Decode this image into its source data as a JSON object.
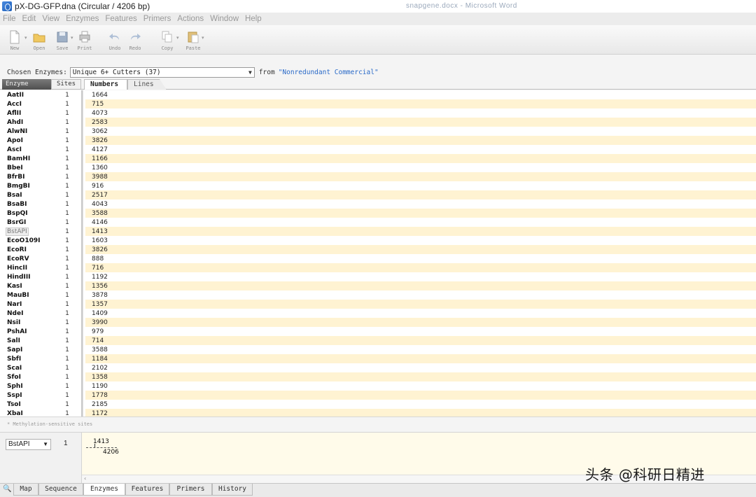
{
  "window": {
    "title": "pX-DG-GFP.dna  (Circular / 4206 bp)",
    "ghost_title": "snapgene.docx  -  Microsoft Word"
  },
  "menu": [
    "File",
    "Edit",
    "View",
    "Enzymes",
    "Features",
    "Primers",
    "Actions",
    "Window",
    "Help"
  ],
  "toolbar": {
    "new": "New",
    "open": "Open",
    "save": "Save",
    "print": "Print",
    "undo": "Undo",
    "redo": "Redo",
    "copy": "Copy",
    "paste": "Paste"
  },
  "chosen": {
    "label": "Chosen Enzymes:",
    "value": "Unique 6+ Cutters  (37)",
    "from_label": "from",
    "from_value": "\"Nonredundant Commercial\""
  },
  "headers": {
    "enzyme": "Enzyme",
    "sites": "Sites"
  },
  "tabs": {
    "numbers": "Numbers",
    "lines": "Lines"
  },
  "enzymes": [
    {
      "name": "AatII",
      "sites": "1",
      "pos": "1664"
    },
    {
      "name": "AccI",
      "sites": "1",
      "pos": "715"
    },
    {
      "name": "AflII",
      "sites": "1",
      "pos": "4073"
    },
    {
      "name": "AhdI",
      "sites": "1",
      "pos": "2583"
    },
    {
      "name": "AlwNI",
      "sites": "1",
      "pos": "3062"
    },
    {
      "name": "ApoI",
      "sites": "1",
      "pos": "3826"
    },
    {
      "name": "AscI",
      "sites": "1",
      "pos": "4127"
    },
    {
      "name": "BamHI",
      "sites": "1",
      "pos": "1166"
    },
    {
      "name": "BbeI",
      "sites": "1",
      "pos": "1360"
    },
    {
      "name": "BfrBI",
      "sites": "1",
      "pos": "3988"
    },
    {
      "name": "BmgBI",
      "sites": "1",
      "pos": "916"
    },
    {
      "name": "BsaI",
      "sites": "1",
      "pos": "2517"
    },
    {
      "name": "BsaBI",
      "sites": "1",
      "pos": "4043"
    },
    {
      "name": "BspQI",
      "sites": "1",
      "pos": "3588"
    },
    {
      "name": "BsrGI",
      "sites": "1",
      "pos": "4146"
    },
    {
      "name": "BstAPI",
      "sites": "1",
      "pos": "1413"
    },
    {
      "name": "EcoO109I",
      "sites": "1",
      "pos": "1603"
    },
    {
      "name": "EcoRI",
      "sites": "1",
      "pos": "3826"
    },
    {
      "name": "EcoRV",
      "sites": "1",
      "pos": "888"
    },
    {
      "name": "HincII",
      "sites": "1",
      "pos": "716"
    },
    {
      "name": "HindIII",
      "sites": "1",
      "pos": "1192"
    },
    {
      "name": "KasI",
      "sites": "1",
      "pos": "1356"
    },
    {
      "name": "MauBI",
      "sites": "1",
      "pos": "3878"
    },
    {
      "name": "NarI",
      "sites": "1",
      "pos": "1357"
    },
    {
      "name": "NdeI",
      "sites": "1",
      "pos": "1409"
    },
    {
      "name": "NsiI",
      "sites": "1",
      "pos": "3990"
    },
    {
      "name": "PshAI",
      "sites": "1",
      "pos": "979"
    },
    {
      "name": "SalI",
      "sites": "1",
      "pos": "714"
    },
    {
      "name": "SapI",
      "sites": "1",
      "pos": "3588"
    },
    {
      "name": "SbfI",
      "sites": "1",
      "pos": "1184"
    },
    {
      "name": "ScaI",
      "sites": "1",
      "pos": "2102"
    },
    {
      "name": "SfoI",
      "sites": "1",
      "pos": "1358"
    },
    {
      "name": "SphI",
      "sites": "1",
      "pos": "1190"
    },
    {
      "name": "SspI",
      "sites": "1",
      "pos": "1778"
    },
    {
      "name": "TsoI",
      "sites": "1",
      "pos": "2185"
    },
    {
      "name": "XbaI",
      "sites": "1",
      "pos": "1172"
    }
  ],
  "selected_enzyme": "BstAPI",
  "footnote": "* Methylation-sensitive sites",
  "detail": {
    "enzyme": "BstAPI",
    "count": "1",
    "position": "1413",
    "length": "4206"
  },
  "bottom_tabs": [
    "Map",
    "Sequence",
    "Enzymes",
    "Features",
    "Primers",
    "History"
  ],
  "active_bottom_tab": "Enzymes",
  "watermark": "头条 @科研日精进",
  "colors": {
    "row_alt": "#fff3d2",
    "accent_blue": "#2a6ac8",
    "detail_bg": "#fffbea"
  }
}
